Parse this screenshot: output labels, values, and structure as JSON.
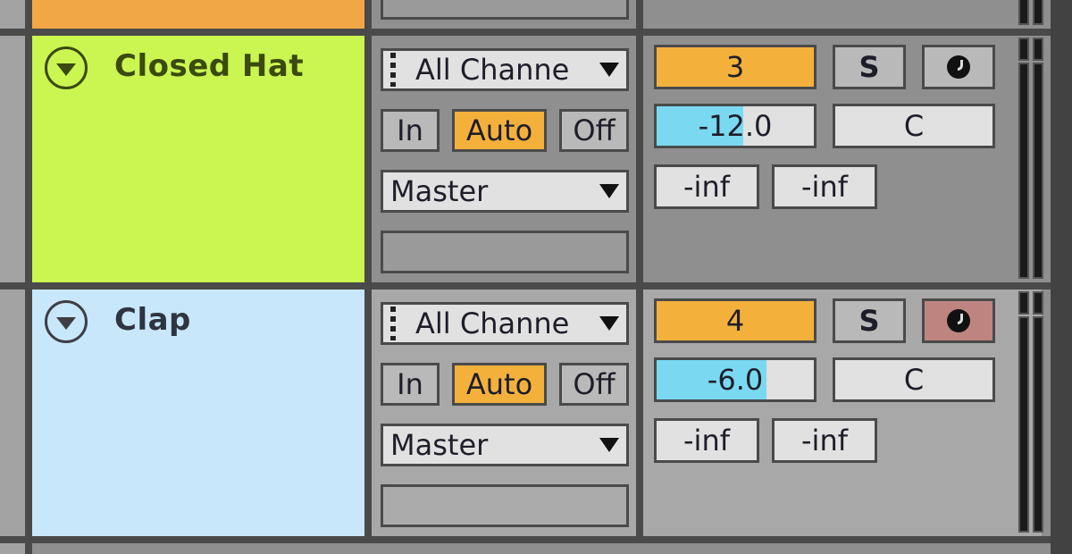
{
  "colors": {
    "prev_track": "#f2a746",
    "io_bg_track1": "#8f8f8f",
    "io_bg_track2": "#a8a8a8",
    "accent_orange": "#f3b13c",
    "volume_fill": "#7ad9f1",
    "arm_active": "#be8580"
  },
  "tracks": [
    {
      "name": "Closed Hat",
      "color": "#cbf550",
      "text_color": "#3a4a10",
      "input_channel": "All Channe",
      "monitor": {
        "in": "In",
        "auto": "Auto",
        "off": "Off",
        "selected": "Auto"
      },
      "output": "Master",
      "number": "3",
      "solo": "S",
      "arm_active": false,
      "volume": "-12.0",
      "volume_fill_fraction": 0.55,
      "pan": "C",
      "meter_left": "-inf",
      "meter_right": "-inf"
    },
    {
      "name": "Clap",
      "color": "#c8e7fb",
      "text_color": "#2e3440",
      "input_channel": "All Channe",
      "monitor": {
        "in": "In",
        "auto": "Auto",
        "off": "Off",
        "selected": "Auto"
      },
      "output": "Master",
      "number": "4",
      "solo": "S",
      "arm_active": true,
      "volume": "-6.0",
      "volume_fill_fraction": 0.7,
      "pan": "C",
      "meter_left": "-inf",
      "meter_right": "-inf"
    }
  ]
}
